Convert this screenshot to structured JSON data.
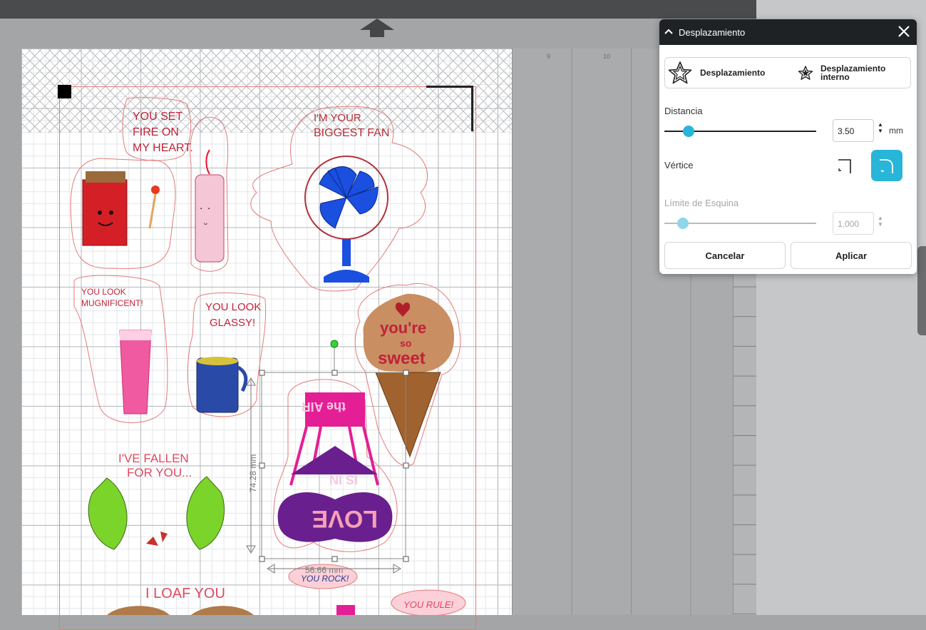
{
  "canvas": {
    "ruler_labels": [
      "9",
      "10"
    ],
    "sticker_texts": {
      "heart": "YOU SET FIRE ON MY HEART.",
      "fan": "I'M YOUR BIGGEST FAN",
      "mug1": "YOU LOOK MUGNIFICENT!",
      "mug2": "YOU LOOK GLASSY!",
      "icecream": "you're so sweet",
      "fallen": "I'VE FALLEN FOR YOU...",
      "loaf": "I LOAF YOU",
      "rock": "YOU ROCK!",
      "rule": "YOU RULE!",
      "love_air_top": "the AIR",
      "love_mid": "IS IN",
      "love_bottom": "LOVE"
    },
    "selection": {
      "height_label": "74.28 mm",
      "width_label": "56.66 mm"
    }
  },
  "dialog": {
    "title": "Desplazamiento",
    "tabs": {
      "offset": "Desplazamiento",
      "inner_offset_line1": "Desplazamiento",
      "inner_offset_line2": "interno"
    },
    "distance": {
      "label": "Distancia",
      "value": "3.50",
      "unit": "mm",
      "slider_fraction": 0.16
    },
    "corner": {
      "label": "Vértice",
      "options": [
        "sharp",
        "rounded"
      ],
      "selected": "rounded"
    },
    "corner_limit": {
      "label": "Límite de Esquina",
      "value": "1.000",
      "slider_fraction": 0.12,
      "enabled": false
    },
    "buttons": {
      "cancel": "Cancelar",
      "apply": "Aplicar"
    }
  },
  "colors": {
    "accent": "#29b5d8",
    "dialog_header": "#1f2225",
    "cut_line": "#e47a7a"
  }
}
